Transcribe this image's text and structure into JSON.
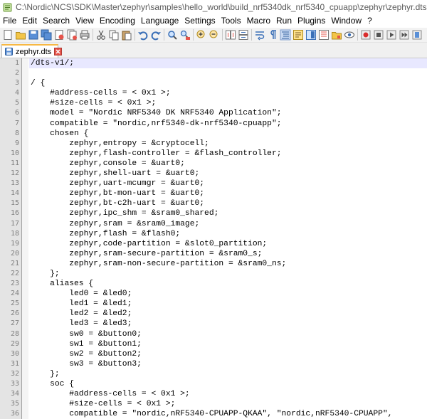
{
  "window": {
    "title": "C:\\Nordic\\NCS\\SDK\\Master\\zephyr\\samples\\hello_world\\build_nrf5340dk_nrf5340_cpuapp\\zephyr\\zephyr.dts - Notepad++"
  },
  "menu": [
    "File",
    "Edit",
    "Search",
    "View",
    "Encoding",
    "Language",
    "Settings",
    "Tools",
    "Macro",
    "Run",
    "Plugins",
    "Window",
    "?"
  ],
  "toolbar": {
    "icons": [
      "new-file-icon",
      "open-file-icon",
      "save-icon",
      "save-all-icon",
      "close-icon",
      "close-all-icon",
      "print-icon",
      "cut-icon",
      "copy-icon",
      "paste-icon",
      "undo-icon",
      "redo-icon",
      "find-icon",
      "replace-icon",
      "zoom-in-icon",
      "zoom-out-icon",
      "sync-vertical-icon",
      "sync-horizontal-icon",
      "word-wrap-icon",
      "show-all-chars-icon",
      "indent-guide-icon",
      "user-lang-icon",
      "doc-map-icon",
      "function-list-icon",
      "folder-workspace-icon",
      "monitoring-icon",
      "record-macro-icon",
      "stop-record-icon",
      "play-macro-icon",
      "run-macro-multiple-icon",
      "save-macro-icon"
    ]
  },
  "tab": {
    "label": "zephyr.dts"
  },
  "colors": {
    "tab_accent": "#f7b844",
    "current_line": "#e8e8ff",
    "gutter_bg": "#e4e4e4",
    "line_number": "#808080"
  },
  "editor": {
    "current_line": 1,
    "lines": [
      {
        "n": "1",
        "text": "/dts-v1/;"
      },
      {
        "n": "2",
        "text": ""
      },
      {
        "n": "3",
        "text": "/ {"
      },
      {
        "n": "4",
        "text": "    #address-cells = < 0x1 >;"
      },
      {
        "n": "5",
        "text": "    #size-cells = < 0x1 >;"
      },
      {
        "n": "6",
        "text": "    model = \"Nordic NRF5340 DK NRF5340 Application\";"
      },
      {
        "n": "7",
        "text": "    compatible = \"nordic,nrf5340-dk-nrf5340-cpuapp\";"
      },
      {
        "n": "8",
        "text": "    chosen {"
      },
      {
        "n": "9",
        "text": "        zephyr,entropy = &cryptocell;"
      },
      {
        "n": "10",
        "text": "        zephyr,flash-controller = &flash_controller;"
      },
      {
        "n": "11",
        "text": "        zephyr,console = &uart0;"
      },
      {
        "n": "12",
        "text": "        zephyr,shell-uart = &uart0;"
      },
      {
        "n": "13",
        "text": "        zephyr,uart-mcumgr = &uart0;"
      },
      {
        "n": "14",
        "text": "        zephyr,bt-mon-uart = &uart0;"
      },
      {
        "n": "15",
        "text": "        zephyr,bt-c2h-uart = &uart0;"
      },
      {
        "n": "16",
        "text": "        zephyr,ipc_shm = &sram0_shared;"
      },
      {
        "n": "17",
        "text": "        zephyr,sram = &sram0_image;"
      },
      {
        "n": "18",
        "text": "        zephyr,flash = &flash0;"
      },
      {
        "n": "19",
        "text": "        zephyr,code-partition = &slot0_partition;"
      },
      {
        "n": "20",
        "text": "        zephyr,sram-secure-partition = &sram0_s;"
      },
      {
        "n": "21",
        "text": "        zephyr,sram-non-secure-partition = &sram0_ns;"
      },
      {
        "n": "22",
        "text": "    };"
      },
      {
        "n": "23",
        "text": "    aliases {"
      },
      {
        "n": "24",
        "text": "        led0 = &led0;"
      },
      {
        "n": "25",
        "text": "        led1 = &led1;"
      },
      {
        "n": "26",
        "text": "        led2 = &led2;"
      },
      {
        "n": "27",
        "text": "        led3 = &led3;"
      },
      {
        "n": "28",
        "text": "        sw0 = &button0;"
      },
      {
        "n": "29",
        "text": "        sw1 = &button1;"
      },
      {
        "n": "30",
        "text": "        sw2 = &button2;"
      },
      {
        "n": "31",
        "text": "        sw3 = &button3;"
      },
      {
        "n": "32",
        "text": "    };"
      },
      {
        "n": "33",
        "text": "    soc {"
      },
      {
        "n": "34",
        "text": "        #address-cells = < 0x1 >;"
      },
      {
        "n": "35",
        "text": "        #size-cells = < 0x1 >;"
      },
      {
        "n": "36",
        "text": "        compatible = \"nordic,nRF5340-CPUAPP-QKAA\", \"nordic,nRF5340-CPUAPP\","
      }
    ]
  }
}
